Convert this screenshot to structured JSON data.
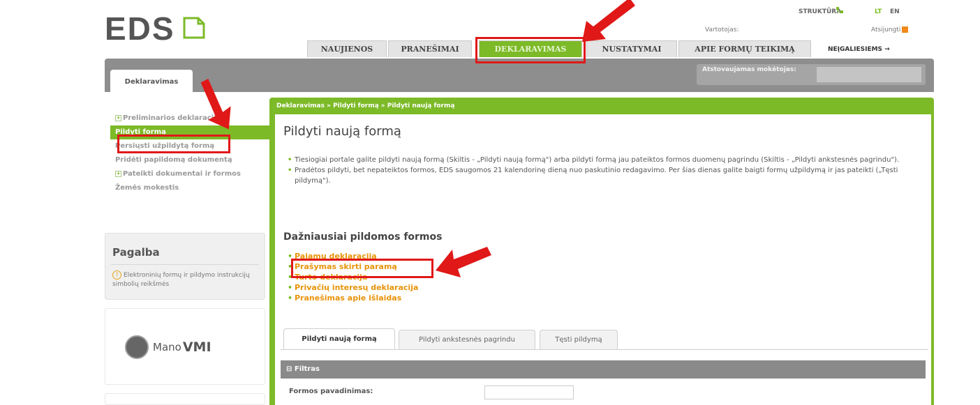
{
  "header": {
    "logo_text": "EDS",
    "structure_link": "STRUKTŪRA",
    "lang_lt": "LT",
    "lang_en": "EN",
    "user_label": "Vartotojas:",
    "logout_label": "Atsijungti",
    "accessibility_link": "NEĮGALIESIEMS →"
  },
  "nav": {
    "tabs": [
      {
        "label": "NAUJIENOS"
      },
      {
        "label": "PRANEŠIMAI"
      },
      {
        "label": "DEKLARAVIMAS"
      },
      {
        "label": "NUSTATYMAI"
      },
      {
        "label": "APIE FORMŲ TEIKIMĄ"
      }
    ]
  },
  "subheader": {
    "section_tab": "Deklaravimas",
    "represented_label": "Atstovaujamas mokėtojas:"
  },
  "sidebar": {
    "items": [
      {
        "label": "Preliminarios deklaracijos"
      },
      {
        "label": "Pildyti formą"
      },
      {
        "label": "Persiųsti užpildytą formą"
      },
      {
        "label": "Pridėti papildomą dokumentą"
      },
      {
        "label": "Pateikti dokumentai ir formos"
      },
      {
        "label": "Žemės mokestis"
      }
    ],
    "help_title": "Pagalba",
    "help_link": "Elektroninių formų ir pildymo instrukcijų simbolių reikšmės",
    "vmi_logo": "Mano",
    "vmi_logo_bold": "VMI"
  },
  "main": {
    "breadcrumb": "Deklaravimas » Pildyti formą » Pildyti naują formą",
    "title": "Pildyti naują formą",
    "info": [
      "Tiesiogiai portale galite pildyti naują formą (Skiltis - „Pildyti naują formą\") arba pildyti formą jau pateiktos formos duomenų pagrindu (Skiltis - „Pildyti ankstesnės pagrindu\").",
      "Pradėtos pildyti, bet nepateiktos formos, EDS saugomos 21 kalendorinę dieną nuo paskutinio redagavimo. Per šias dienas galite baigti formų užpildymą ir jas pateikti („Tęsti pildymą\")."
    ],
    "frequent_title": "Dažniausiai pildomos formos",
    "frequent_forms": [
      {
        "label": "Pajamų deklaracija"
      },
      {
        "label": "Prašymas skirti paramą"
      },
      {
        "label": "Turto deklaracija"
      },
      {
        "label": "Privačių interesų deklaracija"
      },
      {
        "label": "Pranešimas apie išlaidas"
      }
    ],
    "subtabs": [
      {
        "label": "Pildyti naują formą"
      },
      {
        "label": "Pildyti ankstesnės pagrindu"
      },
      {
        "label": "Tęsti pildymą"
      }
    ],
    "filter_title": "Filtras",
    "filter_label": "Formos pavadinimas:",
    "filter_value": ""
  },
  "colors": {
    "brand_green": "#7dba28",
    "link_orange": "#e8930a",
    "annotation_red": "#e01818"
  }
}
